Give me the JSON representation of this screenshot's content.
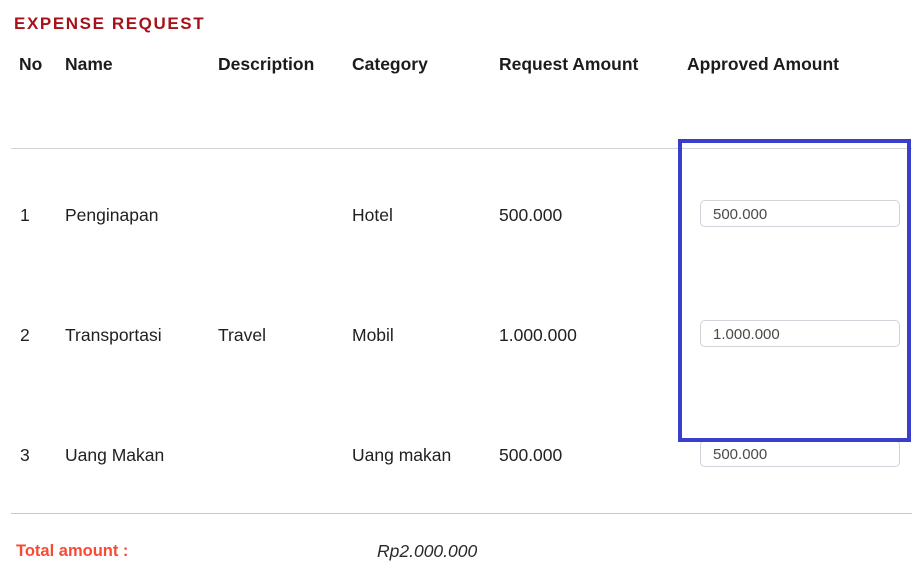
{
  "section": {
    "title": "EXPENSE REQUEST",
    "title_color": "#a6121a"
  },
  "table": {
    "columns": {
      "no": "No",
      "name": "Name",
      "description": "Description",
      "category": "Category",
      "request_amount": "Request Amount",
      "approved_amount": "Approved Amount"
    },
    "rows": [
      {
        "no": "1",
        "name": "Penginapan",
        "description": "",
        "category": "Hotel",
        "request_amount": "500.000",
        "approved_amount": "500.000"
      },
      {
        "no": "2",
        "name": "Transportasi",
        "description": "Travel",
        "category": "Mobil",
        "request_amount": "1.000.000",
        "approved_amount": "1.000.000"
      },
      {
        "no": "3",
        "name": "Uang Makan",
        "description": "",
        "category": "Uang makan",
        "request_amount": "500.000",
        "approved_amount": "500.000"
      }
    ]
  },
  "highlight": {
    "color": "#3a3fcb",
    "target": "approved-amount-column"
  },
  "footer": {
    "total_label": "Total amount :",
    "total_value": "Rp2.000.000",
    "total_label_color": "#f64b36"
  }
}
